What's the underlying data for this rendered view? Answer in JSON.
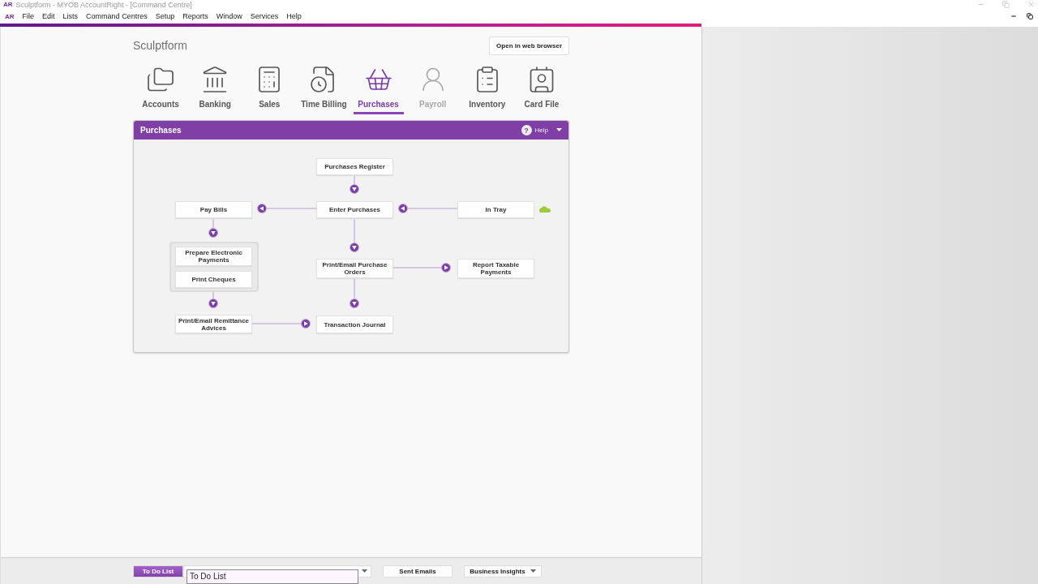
{
  "window": {
    "logo": "AR",
    "title": "Sculptform - MYOB AccountRight - [Command Centre]"
  },
  "menu": {
    "logo": "AR",
    "items": [
      "File",
      "Edit",
      "Lists",
      "Command Centres",
      "Setup",
      "Reports",
      "Window",
      "Services",
      "Help"
    ]
  },
  "company": "Sculptform",
  "open_browser_button": "Open in web browser",
  "command_centres": [
    {
      "label": "Accounts",
      "selected": false,
      "disabled": false
    },
    {
      "label": "Banking",
      "selected": false,
      "disabled": false
    },
    {
      "label": "Sales",
      "selected": false,
      "disabled": false
    },
    {
      "label": "Time Billing",
      "selected": false,
      "disabled": false
    },
    {
      "label": "Purchases",
      "selected": true,
      "disabled": false
    },
    {
      "label": "Payroll",
      "selected": false,
      "disabled": true
    },
    {
      "label": "Inventory",
      "selected": false,
      "disabled": false
    },
    {
      "label": "Card File",
      "selected": false,
      "disabled": false
    }
  ],
  "panel": {
    "title": "Purchases",
    "help_icon": "?",
    "help": "Help",
    "nodes": [
      "Purchases Register",
      "Pay Bills",
      "Enter Purchases",
      "In Tray",
      "Prepare Electronic Payments",
      "Print Cheques",
      "Print/Email Purchase Orders",
      "Report Taxable Payments",
      "Print/Email Remittance Advices",
      "Transaction Journal"
    ],
    "arrows": [
      {
        "kind": "down"
      },
      {
        "kind": "left"
      },
      {
        "kind": "left"
      },
      {
        "kind": "down"
      },
      {
        "kind": "down"
      },
      {
        "kind": "right"
      },
      {
        "kind": "down"
      },
      {
        "kind": "down"
      },
      {
        "kind": "right"
      }
    ]
  },
  "bottom_bar": {
    "buttons": [
      {
        "label": "To Do List",
        "kind": "plain",
        "selected": true
      },
      {
        "kind": "dropdown",
        "selected": false
      },
      {
        "label": "Sent Emails",
        "kind": "plain",
        "selected": false
      },
      {
        "label": "Business Insights",
        "kind": "dropdown",
        "selected": false
      }
    ],
    "tooltip": "To Do List"
  }
}
